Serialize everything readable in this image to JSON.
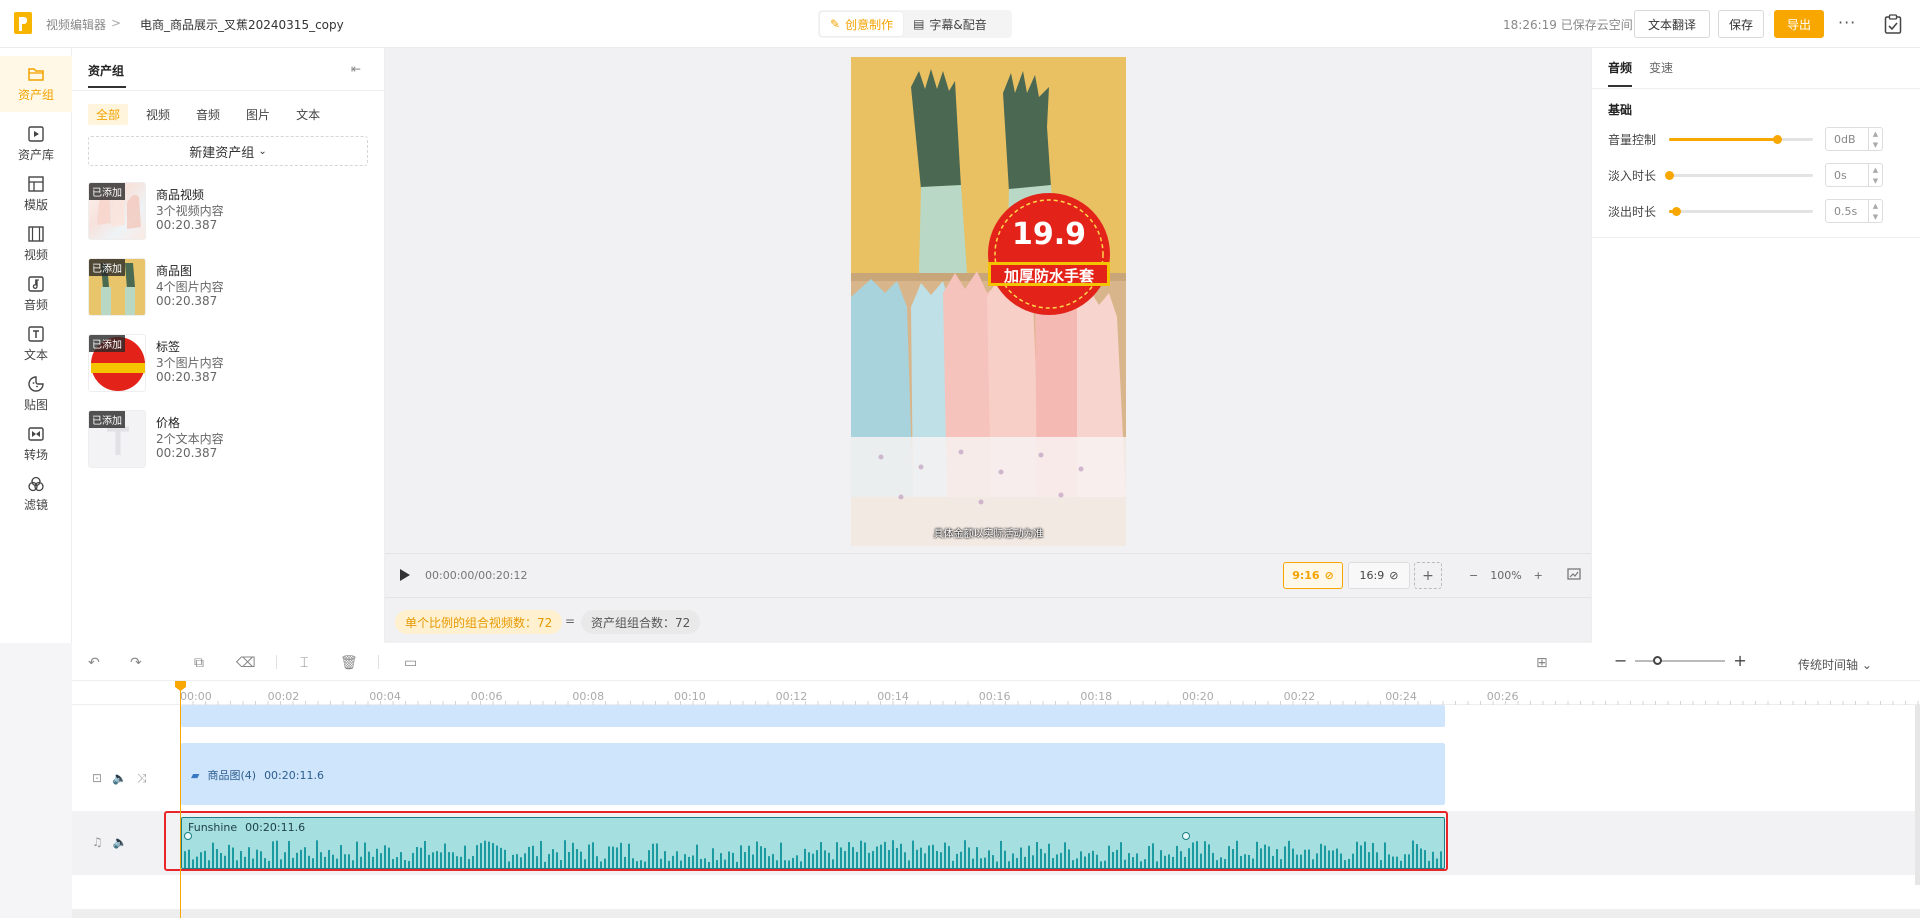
{
  "topbar": {
    "crumb_root": "视频编辑器",
    "crumb_sep": ">",
    "project_title": "电商_商品展示_叉蕉20240315_copy",
    "mode_create": "创意制作",
    "mode_subtitle": "字幕&配音",
    "saved_status": "18:26:19 已保存云空间",
    "translate_button": "文本翻译",
    "save_button": "保存",
    "export_button": "导出",
    "more": "···"
  },
  "nav": {
    "items": [
      {
        "label": "资产组",
        "icon": "folder-icon"
      },
      {
        "label": "资产库",
        "icon": "media-library-icon"
      },
      {
        "label": "模版",
        "icon": "template-icon"
      },
      {
        "label": "视频",
        "icon": "film-icon"
      },
      {
        "label": "音频",
        "icon": "music-note-icon"
      },
      {
        "label": "文本",
        "icon": "text-icon"
      },
      {
        "label": "贴图",
        "icon": "sticker-icon"
      },
      {
        "label": "转场",
        "icon": "transition-icon"
      },
      {
        "label": "滤镜",
        "icon": "filter-icon"
      }
    ]
  },
  "assets": {
    "title": "资产组",
    "filters": [
      "全部",
      "视频",
      "音频",
      "图片",
      "文本"
    ],
    "new_group": "新建资产组",
    "added_badge": "已添加",
    "items": [
      {
        "name": "商品视频",
        "count": "3个视频内容",
        "duration": "00:20.387"
      },
      {
        "name": "商品图",
        "count": "4个图片内容",
        "duration": "00:20.387"
      },
      {
        "name": "标签",
        "count": "3个图片内容",
        "duration": "00:20.387"
      },
      {
        "name": "价格",
        "count": "2个文本内容",
        "duration": "00:20.387"
      }
    ]
  },
  "preview": {
    "price": "19.9",
    "tag_text": "加厚防水手套",
    "caption": "具体金额以实际活动为准",
    "time_display": "00:00:00/00:20:12",
    "ratio_active": "9:16",
    "ratio_other": "16:9",
    "ratio_add": "+",
    "zoom_minus": "−",
    "zoom_level": "100%",
    "zoom_plus": "+",
    "combo_count": "单个比例的组合视频数：72",
    "equals": "=",
    "asset_combo_count": "资产组组合数：72"
  },
  "props": {
    "tab_audio": "音频",
    "tab_speed": "变速",
    "section_basic": "基础",
    "volume_label": "音量控制",
    "volume_value": "0dB",
    "volume_level": 0.75,
    "fadein_label": "淡入时长",
    "fadein_value": "0s",
    "fadein_level": 0.0,
    "fadeout_label": "淡出时长",
    "fadeout_value": "0.5s",
    "fadeout_level": 0.05
  },
  "timeline": {
    "mode_label": "传统时间轴",
    "ticks": [
      "00:00",
      "00:02",
      "00:04",
      "00:06",
      "00:08",
      "00:10",
      "00:12",
      "00:14",
      "00:16",
      "00:18",
      "00:20",
      "00:22",
      "00:24",
      "00:26"
    ],
    "track_image_label": "商品图(4)",
    "track_image_duration": "00:20:11.6",
    "track_audio_label": "Funshine",
    "track_audio_duration": "00:20:11.6"
  },
  "colors": {
    "accent": "#f7a700",
    "highlight": "#e8262a",
    "clip_blue": "#cfe5fb",
    "audio_teal": "#a6dfe0"
  }
}
